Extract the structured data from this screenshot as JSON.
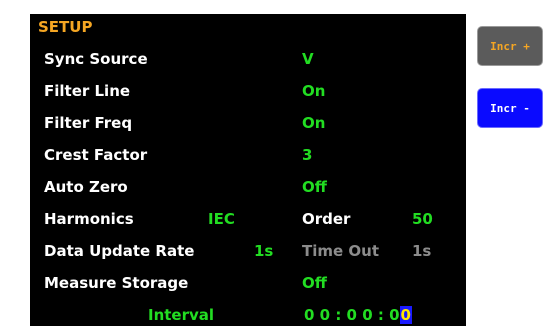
{
  "title": "SETUP",
  "rows": {
    "sync_source": {
      "label": "Sync Source",
      "value": "V"
    },
    "filter_line": {
      "label": "Filter Line",
      "value": "On"
    },
    "filter_freq": {
      "label": "Filter Freq",
      "value": "On"
    },
    "crest_factor": {
      "label": "Crest Factor",
      "value": "3"
    },
    "auto_zero": {
      "label": "Auto Zero",
      "value": "Off"
    },
    "harmonics": {
      "label": "Harmonics",
      "value": "IEC",
      "order_label": "Order",
      "order_value": "50"
    },
    "data_update_rate": {
      "label": "Data Update Rate",
      "value": "1s",
      "timeout_label": "Time Out",
      "timeout_value": "1s"
    },
    "measure_storage": {
      "label": "Measure Storage",
      "value": "Off"
    },
    "interval": {
      "label": "Interval",
      "value_prefix": "0 0 : 0 0 : 0",
      "value_cursor": "0"
    }
  },
  "buttons": {
    "incr_plus": "Incr +",
    "incr_minus": "Incr -"
  },
  "colors": {
    "screen_bg": "#000000",
    "title": "#f5a623",
    "label": "#ffffff",
    "value": "#22dd22",
    "disabled": "#8c8c8c",
    "cursor_bg": "#1a1aff",
    "cursor_fg": "#ffe600",
    "incr_minus_bg": "#0a0aff",
    "incr_plus_bg": "#5b5b5b"
  }
}
